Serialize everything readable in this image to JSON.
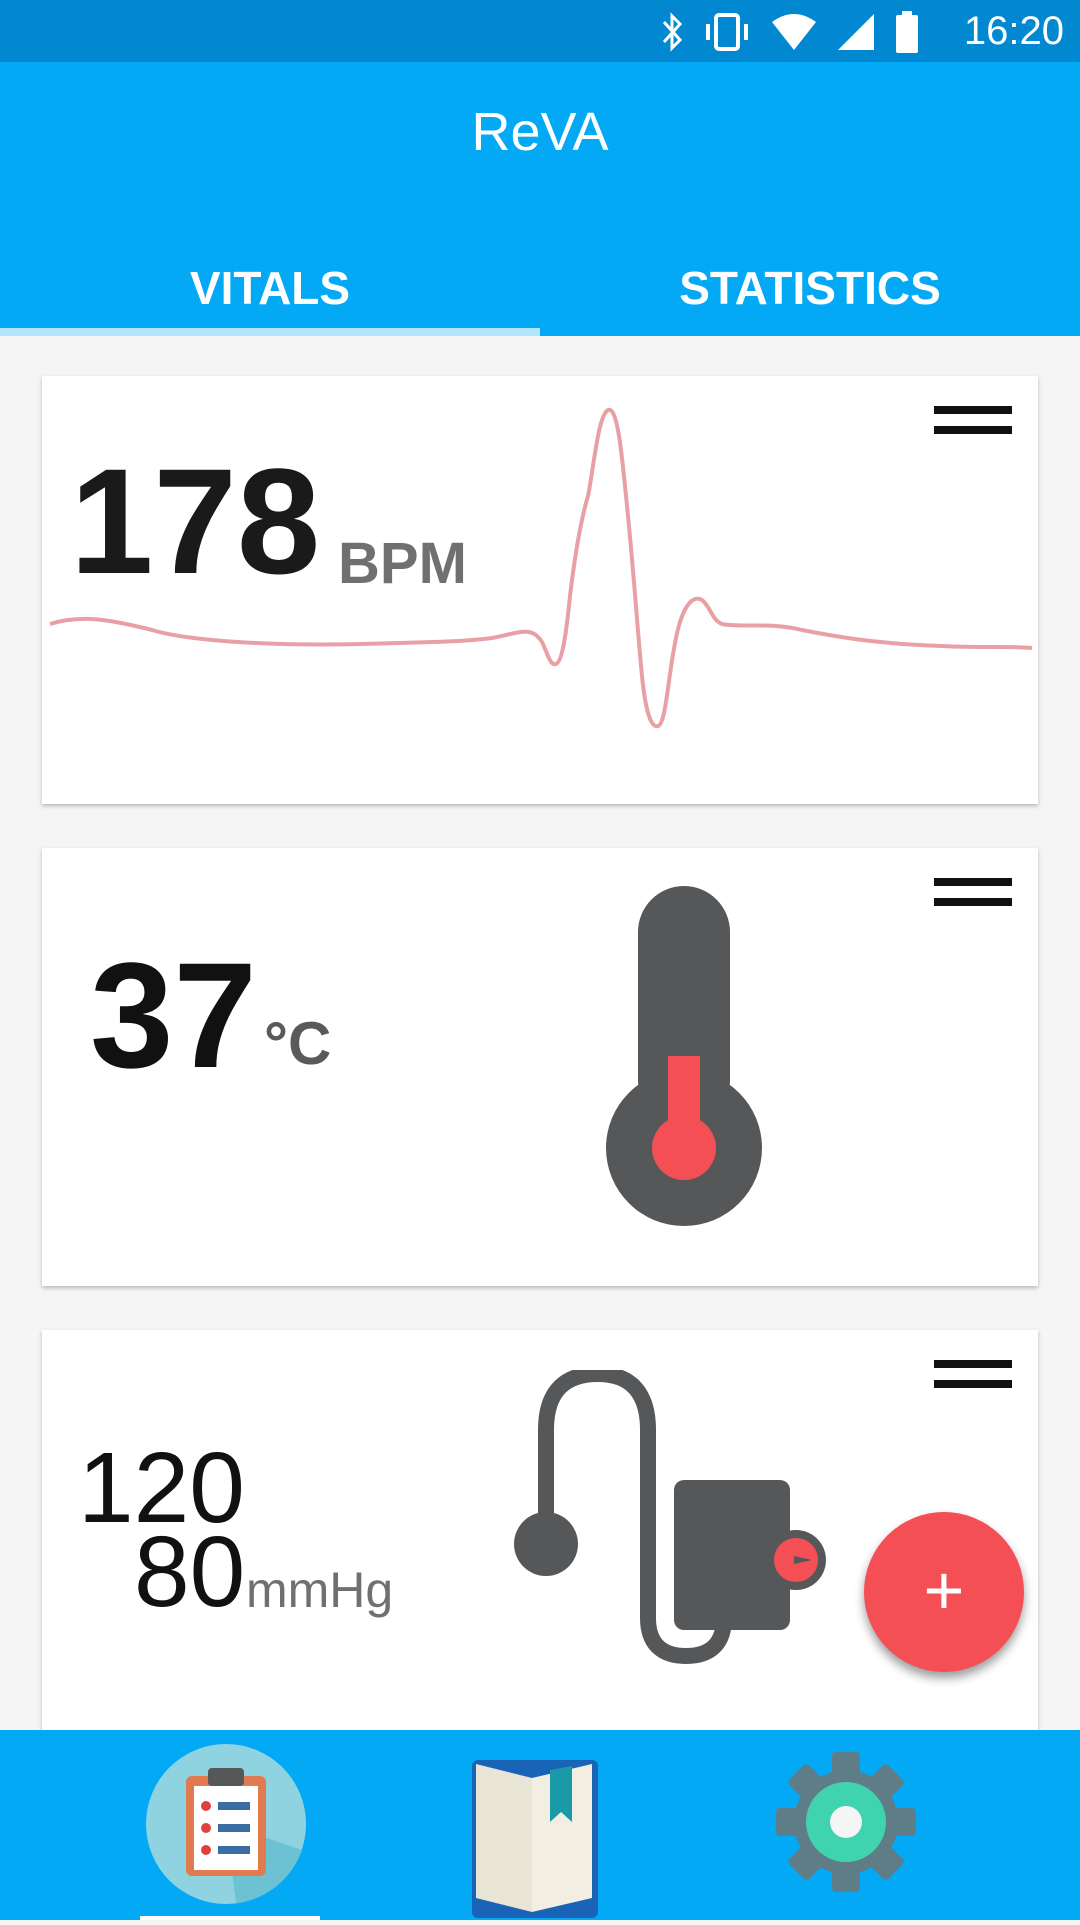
{
  "status_bar": {
    "time": "16:20",
    "icons": [
      "bluetooth-icon",
      "vibrate-icon",
      "wifi-icon",
      "signal-icon",
      "battery-icon"
    ]
  },
  "app_bar": {
    "title": "ReVA",
    "tabs": [
      {
        "label": "VITALS",
        "selected": true
      },
      {
        "label": "STATISTICS",
        "selected": false
      }
    ]
  },
  "cards": {
    "heart_rate": {
      "value": "178",
      "unit": "BPM"
    },
    "temperature": {
      "value": "37",
      "unit": "°C"
    },
    "blood_pressure": {
      "systolic": "120",
      "diastolic": "80",
      "unit": "mmHg"
    }
  },
  "fab": {
    "label": "+"
  },
  "bottom_nav": {
    "items": [
      {
        "icon": "clipboard-icon",
        "selected": true
      },
      {
        "icon": "book-icon",
        "selected": false
      },
      {
        "icon": "gear-icon",
        "selected": false
      }
    ]
  },
  "colors": {
    "primary": "#03a9f4",
    "primary_dark": "#0288d1",
    "accent": "#f44f55",
    "icon_dark": "#555759",
    "ecg_line": "#e8a0a4"
  }
}
